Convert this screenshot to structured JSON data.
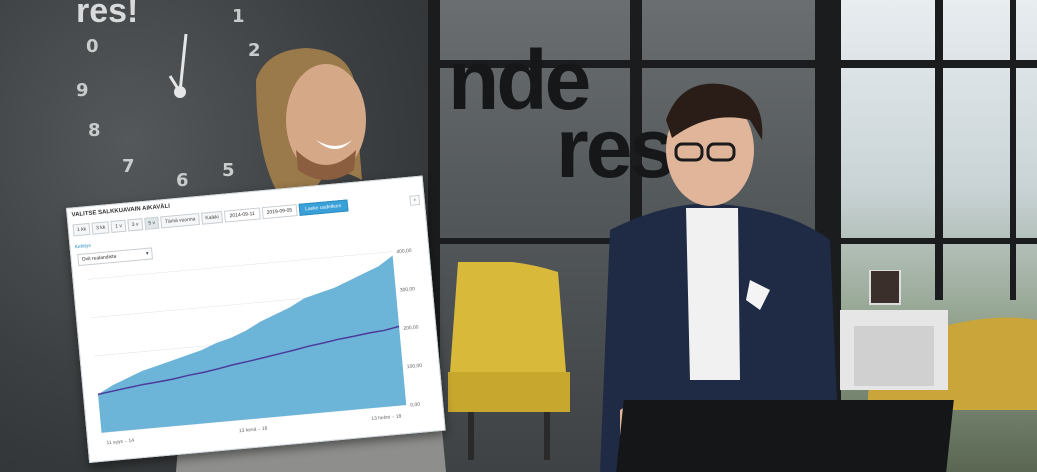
{
  "scene": {
    "wall_logo": "res!",
    "glass_logo_top": "nde",
    "glass_logo_bottom": "res",
    "clock_numbers": [
      "1",
      "0",
      "2",
      "9",
      "8",
      "7",
      "6",
      "5"
    ]
  },
  "chart_card": {
    "title": "VALITSE SALKKUAVAIN AIKAVÄLI",
    "range_buttons": [
      "1 kk",
      "3 kk",
      "1 v",
      "3 v",
      "5 v",
      "Tämä vuonna",
      "Kaikki"
    ],
    "selected_range": "5 v",
    "date_from": "2014-09-11",
    "date_to": "2019-09-05",
    "apply_label": "Laske uudelleen",
    "section_title": "Kehitys",
    "dropdown_value": "Ovit realandista",
    "next_icon": "›",
    "y_tick_labels": [
      "400,00",
      "300,00",
      "200,00",
      "100,00",
      "0,00"
    ],
    "x_tick_labels": [
      "11 syys – 14",
      "13 kesä – 16",
      "13 helmi – 18"
    ]
  },
  "chart_data": {
    "type": "area",
    "x": [
      0,
      1,
      2,
      3,
      4,
      5,
      6,
      7,
      8,
      9,
      10,
      11,
      12,
      13,
      14,
      15,
      16,
      17,
      18,
      19,
      20
    ],
    "series": [
      {
        "values": [
          100,
          120,
          135,
          150,
          160,
          170,
          180,
          190,
          205,
          215,
          230,
          250,
          265,
          280,
          300,
          310,
          320,
          335,
          350,
          365,
          390
        ]
      },
      {
        "values": [
          100,
          105,
          110,
          115,
          118,
          122,
          128,
          132,
          138,
          145,
          150,
          156,
          162,
          168,
          175,
          180,
          186,
          190,
          195,
          198,
          205
        ]
      }
    ],
    "ylim": [
      0,
      400
    ],
    "colors": {
      "area": "#6db5d8",
      "line": "#4b3b9a"
    },
    "grid": true
  }
}
